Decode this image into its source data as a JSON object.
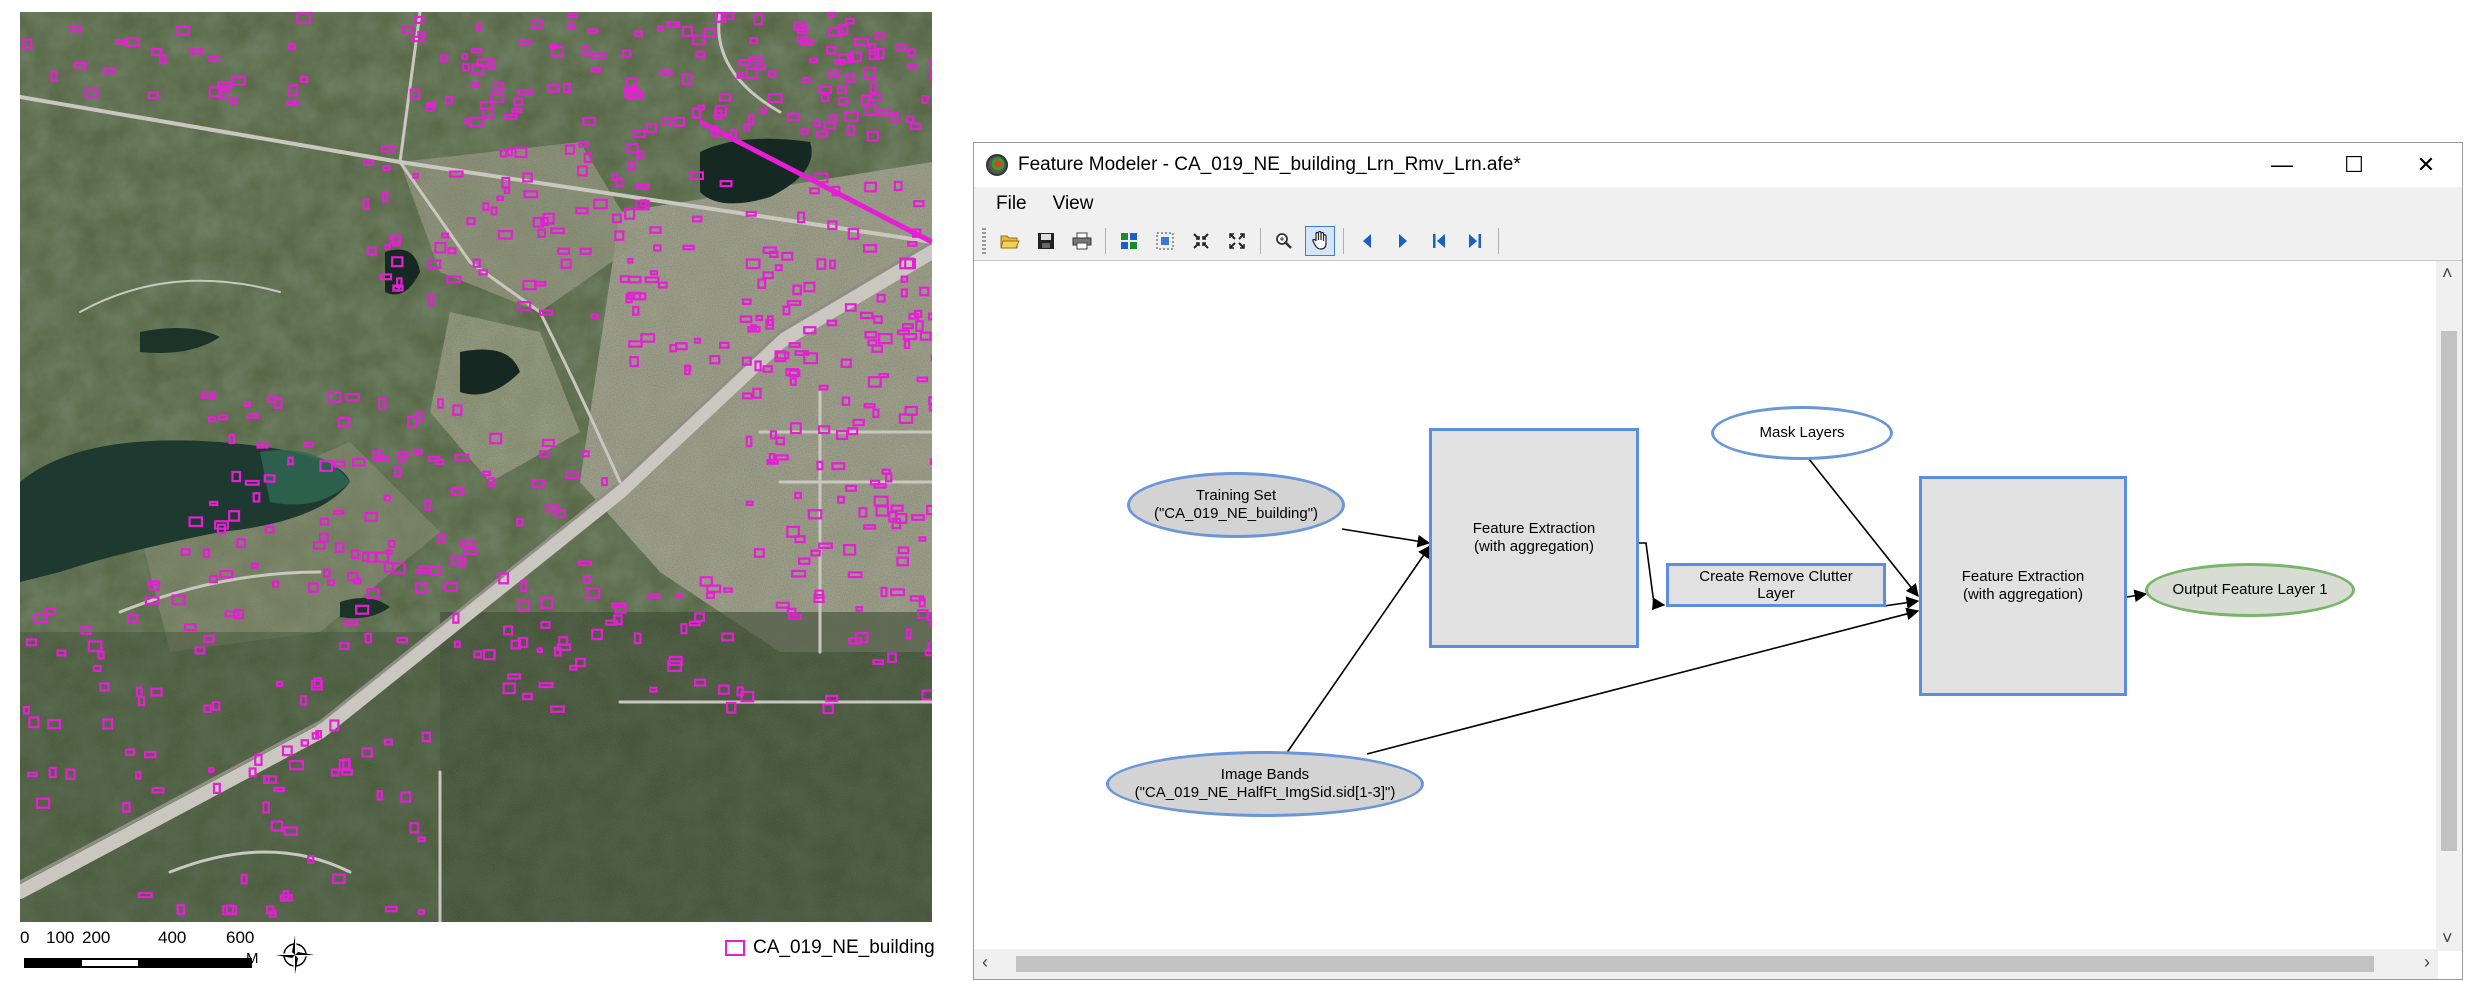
{
  "map": {
    "scale_ticks": [
      "0",
      "100",
      "200",
      "400",
      "600"
    ],
    "scale_unit": "M",
    "legend_label": "CA_019_NE_building",
    "building_color": "#e61fd6"
  },
  "window": {
    "title": "Feature Modeler - CA_019_NE_building_Lrn_Rmv_Lrn.afe*",
    "controls": {
      "minimize": "—",
      "maximize": "☐",
      "close": "✕"
    },
    "menu": [
      "File",
      "View"
    ],
    "toolbar": [
      "open-icon",
      "save-icon",
      "print-icon",
      "layout-icon",
      "fit-icon",
      "collapse-icon",
      "expand-icon",
      "zoom-icon",
      "pan-icon",
      "prev-icon",
      "next-icon",
      "first-icon",
      "last-icon"
    ],
    "accent": "#5b8ee0"
  },
  "graph": {
    "training_set": "Training Set\n(\"CA_019_NE_building\")",
    "image_bands": "Image Bands\n(\"CA_019_NE_HalfFt_ImgSid.sid[1-3]\")",
    "mask_layers": "Mask Layers",
    "feature_extraction_1": "Feature Extraction\n(with aggregation)",
    "remove_clutter": "Create Remove Clutter\nLayer",
    "feature_extraction_2": "Feature Extraction\n(with aggregation)",
    "output": "Output Feature Layer 1"
  }
}
